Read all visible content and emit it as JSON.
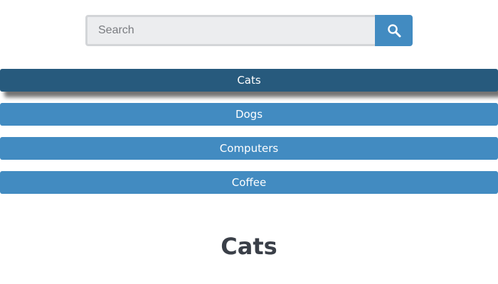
{
  "search": {
    "placeholder": "Search",
    "value": "",
    "button_icon": "search-icon"
  },
  "tabs": [
    {
      "label": "Cats",
      "active": true
    },
    {
      "label": "Dogs",
      "active": false
    },
    {
      "label": "Computers",
      "active": false
    },
    {
      "label": "Coffee",
      "active": false
    }
  ],
  "content": {
    "heading": "Cats"
  },
  "colors": {
    "tab": "#428bc1",
    "tab_active": "#275a7d",
    "search_button": "#428bc1",
    "heading": "#3a3f48"
  }
}
